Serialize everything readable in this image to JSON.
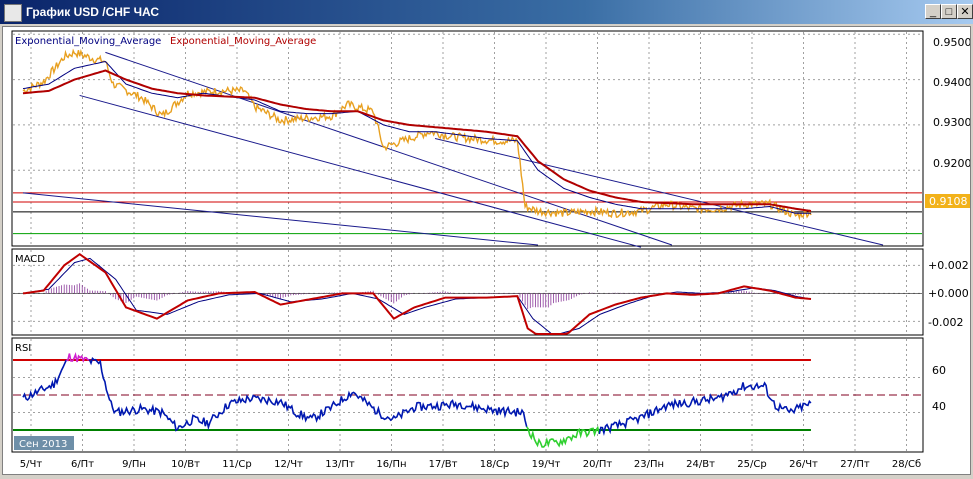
{
  "window": {
    "title": "График USD /CHF ЧАС",
    "buttons": {
      "minimize": "_",
      "maximize": "□",
      "close": "✕"
    }
  },
  "chart_data": [
    {
      "panel": "price",
      "type": "line",
      "indicators": [
        "Exponential_Moving_Average",
        "Exponential_Moving_Average"
      ],
      "indicator_colors": [
        "#000080",
        "#b00000"
      ],
      "ylim": [
        0.9035,
        0.9505
      ],
      "y_ticks": [
        "0.9500",
        "0.9400",
        "0.9300",
        "0.9200"
      ],
      "current_price": "0.9108",
      "horizontal_levels": [
        {
          "value": 0.915,
          "color": "#d00000"
        },
        {
          "value": 0.913,
          "color": "#d00000"
        },
        {
          "value": 0.9108,
          "color": "#000000"
        },
        {
          "value": 0.906,
          "color": "#00a000"
        }
      ],
      "x_categories": [
        "5/Чт",
        "6/Пт",
        "9/Пн",
        "10/Вт",
        "11/Ср",
        "12/Чт",
        "13/Пт",
        "16/Пн",
        "17/Вт",
        "18/Ср",
        "19/Чт",
        "20/Пт",
        "23/Пн",
        "24/Вт",
        "25/Ср",
        "26/Чт",
        "27/Пт",
        "28/Сб"
      ],
      "price_keypoints": [
        [
          0,
          0.9375
        ],
        [
          0.4,
          0.9395
        ],
        [
          0.8,
          0.945
        ],
        [
          1,
          0.946
        ],
        [
          1.4,
          0.9445
        ],
        [
          1.6,
          0.944
        ],
        [
          1.75,
          0.939
        ],
        [
          2.3,
          0.936
        ],
        [
          2.7,
          0.932
        ],
        [
          3.2,
          0.937
        ],
        [
          3.8,
          0.9375
        ],
        [
          4.3,
          0.9375
        ],
        [
          4.5,
          0.934
        ],
        [
          5,
          0.931
        ],
        [
          5.5,
          0.9315
        ],
        [
          6,
          0.932
        ],
        [
          6.3,
          0.9345
        ],
        [
          6.8,
          0.933
        ],
        [
          7,
          0.925
        ],
        [
          7.5,
          0.927
        ],
        [
          7.9,
          0.9285
        ],
        [
          8.3,
          0.9275
        ],
        [
          8.7,
          0.927
        ],
        [
          9.2,
          0.9265
        ],
        [
          9.6,
          0.9265
        ],
        [
          9.75,
          0.912
        ],
        [
          10,
          0.911
        ],
        [
          10.5,
          0.9105
        ],
        [
          11,
          0.911
        ],
        [
          11.5,
          0.9105
        ],
        [
          12,
          0.911
        ],
        [
          12.5,
          0.9125
        ],
        [
          13,
          0.9115
        ],
        [
          13.5,
          0.9115
        ],
        [
          14,
          0.9125
        ],
        [
          14.5,
          0.9125
        ],
        [
          14.8,
          0.911
        ],
        [
          15,
          0.91
        ],
        [
          15.3,
          0.9108
        ]
      ],
      "ema_fast_keypoints": [
        [
          0,
          0.938
        ],
        [
          0.5,
          0.939
        ],
        [
          1,
          0.9425
        ],
        [
          1.6,
          0.944
        ],
        [
          2,
          0.939
        ],
        [
          2.5,
          0.937
        ],
        [
          3,
          0.936
        ],
        [
          3.5,
          0.937
        ],
        [
          4.5,
          0.9355
        ],
        [
          5,
          0.933
        ],
        [
          5.5,
          0.9325
        ],
        [
          6,
          0.9325
        ],
        [
          6.5,
          0.933
        ],
        [
          7,
          0.93
        ],
        [
          7.5,
          0.9285
        ],
        [
          8,
          0.9285
        ],
        [
          9,
          0.927
        ],
        [
          9.6,
          0.9265
        ],
        [
          10,
          0.92
        ],
        [
          10.5,
          0.916
        ],
        [
          11,
          0.914
        ],
        [
          11.5,
          0.9125
        ],
        [
          12,
          0.9115
        ],
        [
          13,
          0.9115
        ],
        [
          14,
          0.9115
        ],
        [
          14.5,
          0.912
        ],
        [
          15,
          0.9105
        ],
        [
          15.3,
          0.9105
        ]
      ],
      "ema_slow_keypoints": [
        [
          0,
          0.937
        ],
        [
          0.5,
          0.9375
        ],
        [
          1,
          0.94
        ],
        [
          1.6,
          0.942
        ],
        [
          2,
          0.94
        ],
        [
          2.5,
          0.938
        ],
        [
          3,
          0.937
        ],
        [
          3.5,
          0.9365
        ],
        [
          4.5,
          0.936
        ],
        [
          5,
          0.9345
        ],
        [
          5.5,
          0.9335
        ],
        [
          6,
          0.933
        ],
        [
          6.5,
          0.933
        ],
        [
          7,
          0.931
        ],
        [
          7.5,
          0.93
        ],
        [
          8,
          0.9295
        ],
        [
          8.5,
          0.929
        ],
        [
          9,
          0.9285
        ],
        [
          9.6,
          0.9275
        ],
        [
          10,
          0.922
        ],
        [
          10.5,
          0.918
        ],
        [
          11,
          0.9155
        ],
        [
          11.5,
          0.914
        ],
        [
          12,
          0.913
        ],
        [
          13,
          0.9125
        ],
        [
          14,
          0.9125
        ],
        [
          14.5,
          0.9125
        ],
        [
          15,
          0.9115
        ],
        [
          15.3,
          0.911
        ]
      ],
      "trendlines": [
        {
          "x1": 1.6,
          "y1": 0.946,
          "x2": 12.6,
          "y2": 0.9035
        },
        {
          "x1": 1.1,
          "y1": 0.9365,
          "x2": 12.0,
          "y2": 0.903
        },
        {
          "x1": 0.0,
          "y1": 0.915,
          "x2": 10.0,
          "y2": 0.9035
        },
        {
          "x1": 8.0,
          "y1": 0.927,
          "x2": 16.7,
          "y2": 0.9035
        }
      ]
    },
    {
      "panel": "macd",
      "type": "line",
      "label": "MACD",
      "ylim": [
        -0.0029,
        0.0031
      ],
      "y_ticks": [
        "+0.002",
        "+0.000",
        "-0.002"
      ],
      "macd_keypoints": [
        [
          0,
          0.0
        ],
        [
          0.4,
          0.0002
        ],
        [
          0.8,
          0.002
        ],
        [
          1.1,
          0.0028
        ],
        [
          1.6,
          0.0015
        ],
        [
          2,
          -0.001
        ],
        [
          2.6,
          -0.0018
        ],
        [
          3.2,
          -0.0005
        ],
        [
          3.8,
          0.0
        ],
        [
          4.5,
          0.0001
        ],
        [
          5,
          -0.0008
        ],
        [
          5.6,
          -0.0004
        ],
        [
          6.2,
          0.0
        ],
        [
          6.8,
          0.0
        ],
        [
          7.2,
          -0.0018
        ],
        [
          7.6,
          -0.001
        ],
        [
          8.2,
          -0.0003
        ],
        [
          9,
          -0.0003
        ],
        [
          9.6,
          -0.0002
        ],
        [
          9.8,
          -0.0025
        ],
        [
          10.2,
          -0.0035
        ],
        [
          10.6,
          -0.0028
        ],
        [
          11,
          -0.0015
        ],
        [
          11.5,
          -0.0008
        ],
        [
          12,
          -0.0003
        ],
        [
          12.5,
          0.0
        ],
        [
          13,
          -0.0001
        ],
        [
          13.5,
          0.0
        ],
        [
          14,
          0.0005
        ],
        [
          14.5,
          0.0002
        ],
        [
          15,
          -0.0003
        ],
        [
          15.3,
          -0.0004
        ]
      ],
      "signal_keypoints": [
        [
          0,
          0.0
        ],
        [
          0.5,
          0.0003
        ],
        [
          1,
          0.0022
        ],
        [
          1.3,
          0.0025
        ],
        [
          1.8,
          0.001
        ],
        [
          2.2,
          -0.0012
        ],
        [
          2.8,
          -0.0015
        ],
        [
          3.4,
          -0.0006
        ],
        [
          4,
          -0.0001
        ],
        [
          4.6,
          0.0
        ],
        [
          5.2,
          -0.0006
        ],
        [
          5.8,
          -0.0004
        ],
        [
          6.4,
          0.0
        ],
        [
          6.9,
          -0.0004
        ],
        [
          7.4,
          -0.0015
        ],
        [
          7.8,
          -0.001
        ],
        [
          8.4,
          -0.0004
        ],
        [
          9,
          -0.0003
        ],
        [
          9.6,
          -0.0002
        ],
        [
          9.9,
          -0.0018
        ],
        [
          10.3,
          -0.003
        ],
        [
          10.8,
          -0.0025
        ],
        [
          11.2,
          -0.0015
        ],
        [
          11.7,
          -0.0008
        ],
        [
          12.2,
          -0.0002
        ],
        [
          12.7,
          0.0001
        ],
        [
          13.2,
          0.0
        ],
        [
          13.7,
          0.0001
        ],
        [
          14.2,
          0.0004
        ],
        [
          14.6,
          0.0002
        ],
        [
          15,
          -0.0002
        ],
        [
          15.3,
          -0.0004
        ]
      ]
    },
    {
      "panel": "rsi",
      "type": "line",
      "label": "RSI",
      "ylim": [
        18,
        82
      ],
      "y_ticks": [
        "60",
        "40"
      ],
      "levels": [
        {
          "value": 70,
          "color": "#d00000",
          "dash": false
        },
        {
          "value": 50,
          "color": "#800020",
          "dash": true
        },
        {
          "value": 30,
          "color": "#008000",
          "dash": false
        }
      ],
      "rsi_keypoints": [
        [
          0,
          48
        ],
        [
          0.3,
          52
        ],
        [
          0.6,
          56
        ],
        [
          0.9,
          72
        ],
        [
          1.2,
          70
        ],
        [
          1.5,
          68
        ],
        [
          1.7,
          45
        ],
        [
          1.8,
          40
        ],
        [
          2.3,
          42
        ],
        [
          2.7,
          40
        ],
        [
          3,
          31
        ],
        [
          3.3,
          36
        ],
        [
          3.6,
          34
        ],
        [
          4,
          45
        ],
        [
          4.4,
          48
        ],
        [
          4.8,
          47
        ],
        [
          5,
          46
        ],
        [
          5.3,
          40
        ],
        [
          5.6,
          36
        ],
        [
          6,
          43
        ],
        [
          6.4,
          52
        ],
        [
          6.6,
          47
        ],
        [
          6.9,
          40
        ],
        [
          7.2,
          36
        ],
        [
          7.6,
          43
        ],
        [
          8.1,
          44
        ],
        [
          8.5,
          45
        ],
        [
          8.8,
          43
        ],
        [
          9.2,
          41
        ],
        [
          9.7,
          40
        ],
        [
          9.8,
          31
        ],
        [
          10,
          22
        ],
        [
          10.4,
          23
        ],
        [
          10.8,
          28
        ],
        [
          11.2,
          30
        ],
        [
          11.6,
          33
        ],
        [
          12,
          37
        ],
        [
          12.5,
          44
        ],
        [
          13,
          46
        ],
        [
          13.5,
          48
        ],
        [
          14,
          55
        ],
        [
          14.4,
          55
        ],
        [
          14.6,
          44
        ],
        [
          14.9,
          40
        ],
        [
          15.1,
          43
        ],
        [
          15.3,
          45
        ]
      ],
      "time_badge": "Сен 2013"
    }
  ]
}
